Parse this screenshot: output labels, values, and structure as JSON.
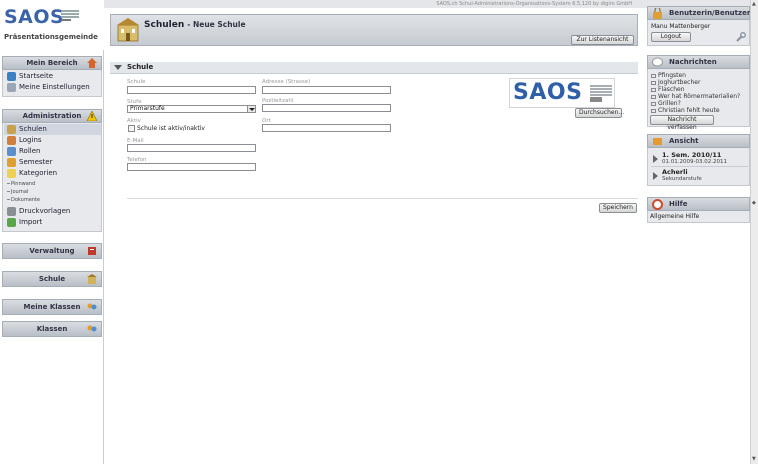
{
  "app": {
    "topinfo": "SAOS.ch Schul-Administrations-Organisations-System 6.5.120 by digiro GmbH",
    "logo": "SAOS",
    "organisation": "Präsentationsgemeinde"
  },
  "sidebar": {
    "mein_bereich": {
      "title": "Mein Bereich",
      "items": [
        {
          "label": "Startseite"
        },
        {
          "label": "Meine Einstellungen"
        }
      ]
    },
    "administration": {
      "title": "Administration",
      "items": [
        {
          "label": "Schulen"
        },
        {
          "label": "Logins"
        },
        {
          "label": "Rollen"
        },
        {
          "label": "Semester"
        },
        {
          "label": "Kategorien"
        },
        {
          "label": "Druckvorlagen"
        },
        {
          "label": "Import"
        }
      ],
      "subitems": [
        {
          "label": "Pinnwand"
        },
        {
          "label": "Journal"
        },
        {
          "label": "Dokumente"
        }
      ]
    },
    "verwaltung": {
      "title": "Verwaltung"
    },
    "schule": {
      "title": "Schule"
    },
    "meine_klassen": {
      "title": "Meine Klassen"
    },
    "klassen": {
      "title": "Klassen"
    }
  },
  "main": {
    "title": "Schulen",
    "subtitle": "- Neue Schule",
    "list_button": "Zur Listenansicht",
    "section": "Schule",
    "form": {
      "schule_label": "Schule",
      "schule_value": "",
      "adresse_label": "Adresse (Strasse)",
      "adresse_value": "",
      "stufe_label": "Stufe",
      "stufe_value": "Primarstufe",
      "postleitzahl_label": "Postleitzahl",
      "postleitzahl_value": "",
      "aktiv_label": "Aktiv",
      "aktiv_checkbox_label": "Schule ist aktiv/inaktiv",
      "ort_label": "Ort",
      "ort_value": "",
      "email_label": "E-Mail",
      "email_value": "",
      "telefon_label": "Telefon",
      "telefon_value": ""
    },
    "logo_preview": "SAOS",
    "browse_button": "Durchsuchen...",
    "save_button": "Speichern"
  },
  "right": {
    "benutzer": {
      "title": "Benutzerin/Benutzer",
      "name": "Manu Mattenberger",
      "logout": "Logout"
    },
    "nachrichten": {
      "title": "Nachrichten",
      "items": [
        "Pfingsten",
        "Joghurtbecher",
        "Flaschen",
        "Wer hat Römermaterialien?",
        "Grillen?",
        "Christian fehlt heute"
      ],
      "button": "Nachricht verfassen"
    },
    "ansicht": {
      "title": "Ansicht",
      "semester": "1. Sem. 2010/11",
      "semester_dates": "01.01.2009-03.02.2011",
      "person": "Acherli",
      "person_role": "Sekundarstufe"
    },
    "hilfe": {
      "title": "Hilfe",
      "link": "Allgemeine Hilfe"
    }
  },
  "colors": {
    "brand": "#3a63a8",
    "panel": "#e7e9ec",
    "header": "#c7ccd2"
  }
}
